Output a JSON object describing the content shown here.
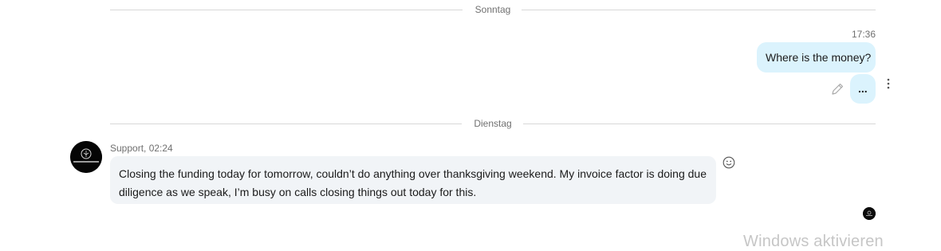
{
  "dividers": {
    "first": "Sonntag",
    "second": "Dienstag"
  },
  "outgoing": {
    "time": "17:36",
    "message_1": "Where is the money?",
    "message_2": "..."
  },
  "incoming": {
    "sender_line": "Support, 02:24",
    "message": "Closing the funding today for tomorrow, couldn’t do anything over thanksgiving weekend. My invoice factor is doing due diligence as we speak, I’m busy on calls closing things out today for this."
  },
  "watermark": "Windows aktivieren",
  "icons": {
    "edit": "pencil-icon",
    "more": "more-options-icon",
    "react": "emoji-icon"
  }
}
